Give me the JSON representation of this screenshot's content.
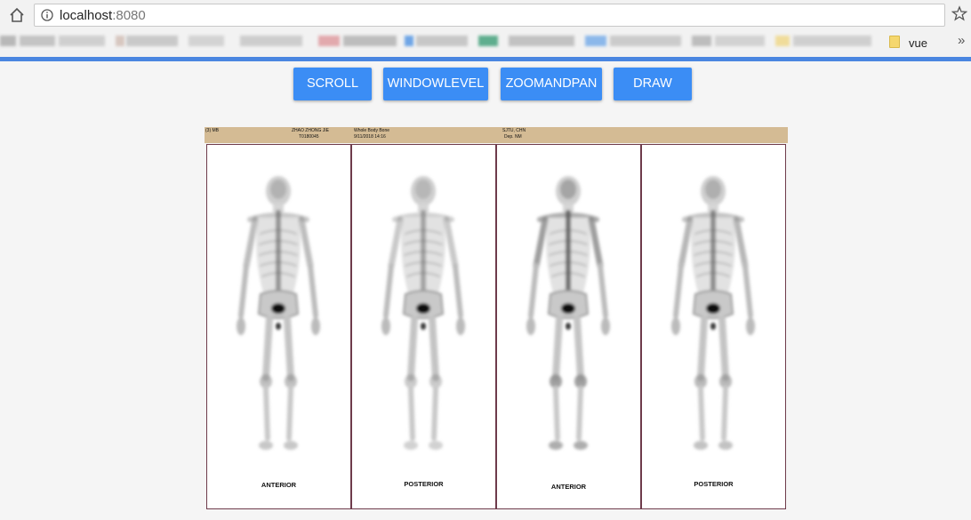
{
  "browser": {
    "url_host": "localhost",
    "url_port": ":8080",
    "bookmark_folder": "vue",
    "more_symbol": "»",
    "icons": [
      "home-icon",
      "info-icon",
      "star-icon",
      "folder-icon"
    ]
  },
  "toolbar": {
    "buttons": [
      {
        "label": "SCROLL"
      },
      {
        "label": "WINDOWLEVEL"
      },
      {
        "label": "ZOOMANDPAN"
      },
      {
        "label": "DRAW"
      }
    ],
    "accent_color": "#3b8df5"
  },
  "viewer": {
    "header": {
      "col1": "(3) MB",
      "col2_line1": "ZHAO ZHONG JIE",
      "col2_line2": "T0180045",
      "col3_line1": "Whole Body Bone",
      "col3_line2": "9/11/2018 14:16",
      "col4_line1": "SJTU, CHN",
      "col4_line2": "Dep. NM"
    },
    "panels": [
      {
        "label": "ANTERIOR"
      },
      {
        "label": "POSTERIOR"
      },
      {
        "label": "ANTERIOR"
      },
      {
        "label": "POSTERIOR"
      }
    ],
    "header_color": "#d4bb94",
    "border_color": "#6e3b4b"
  }
}
